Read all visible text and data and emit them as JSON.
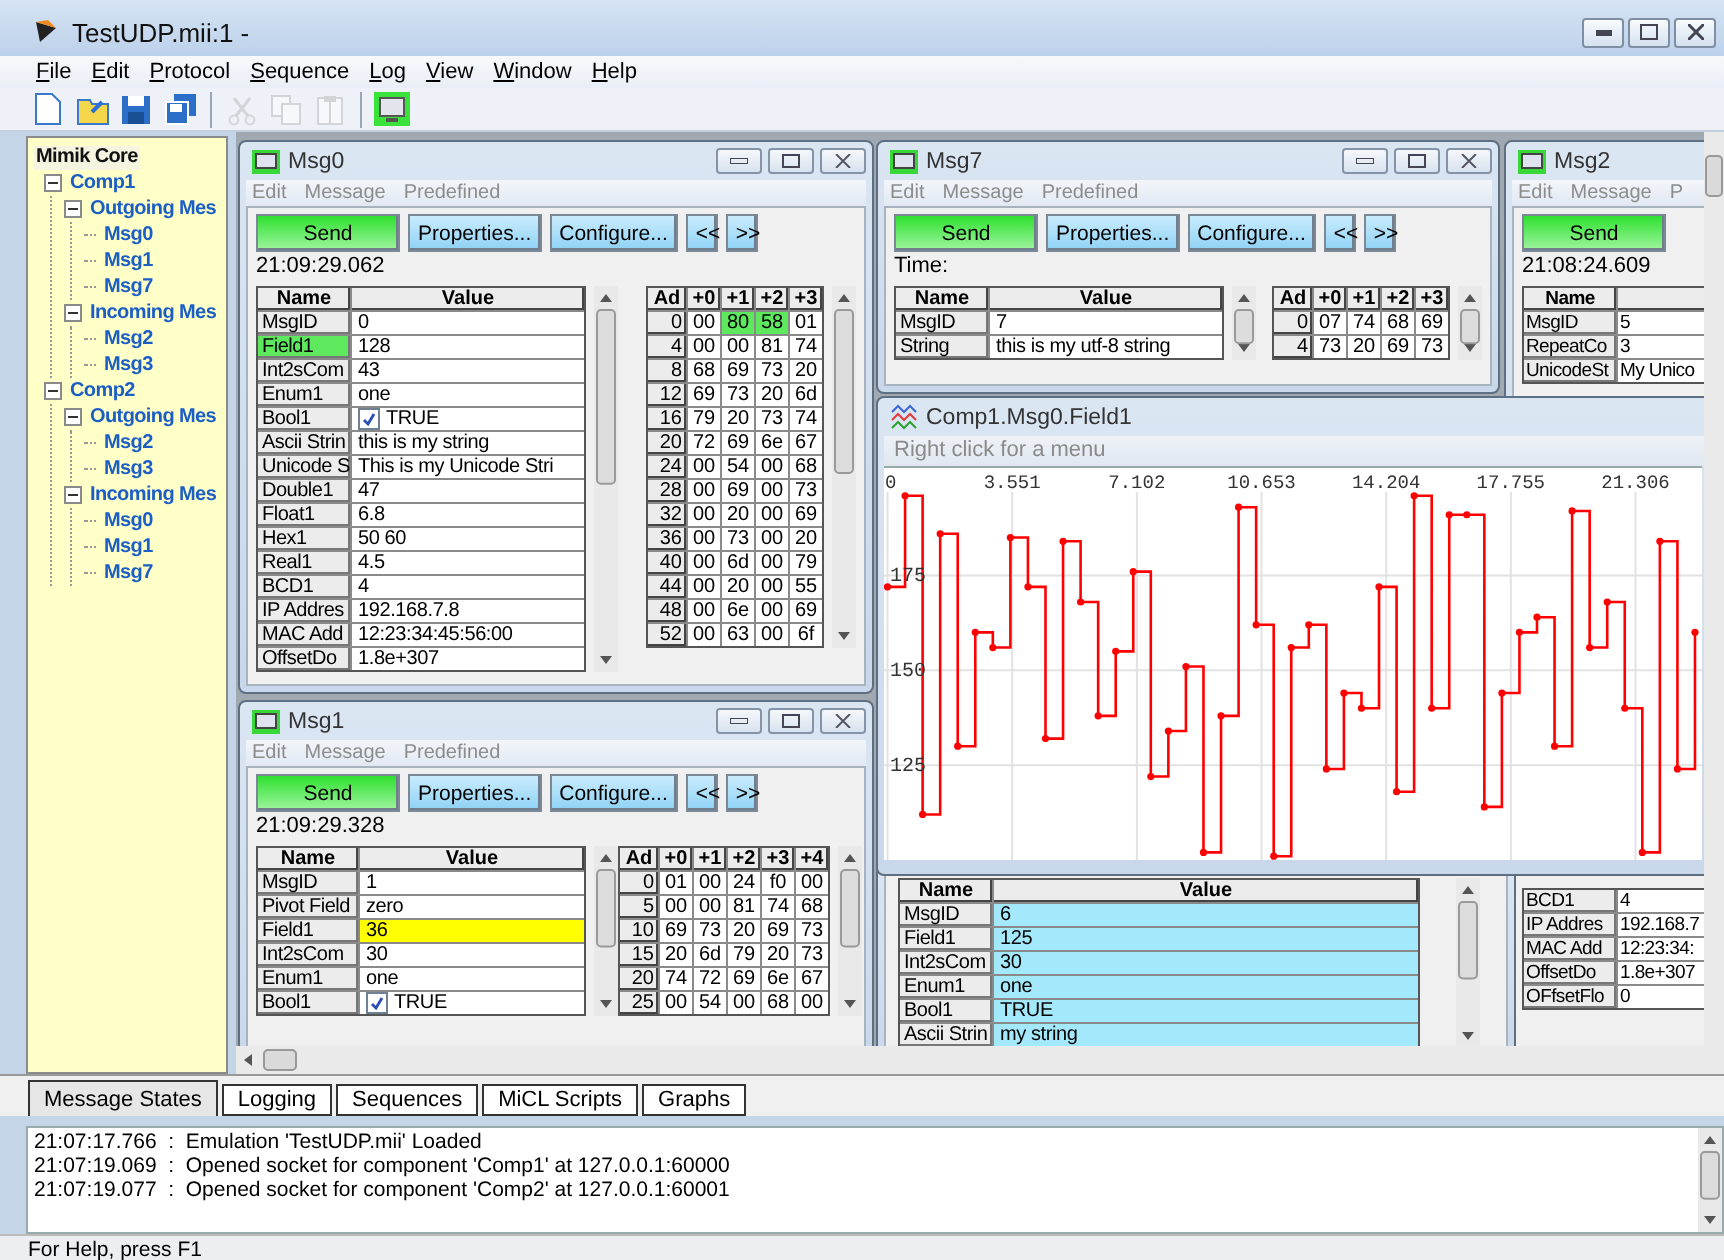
{
  "window": {
    "title": "TestUDP.mii:1 -"
  },
  "menu": [
    "File",
    "Edit",
    "Protocol",
    "Sequence",
    "Log",
    "View",
    "Window",
    "Help"
  ],
  "toolbar": [
    {
      "kind": "new",
      "disabled": false
    },
    {
      "kind": "open",
      "disabled": false
    },
    {
      "kind": "save",
      "disabled": false
    },
    {
      "kind": "save_all",
      "disabled": false
    },
    {
      "kind": "separator"
    },
    {
      "kind": "cut",
      "disabled": true
    },
    {
      "kind": "copy",
      "disabled": true
    },
    {
      "kind": "paste",
      "disabled": true
    },
    {
      "kind": "separator"
    },
    {
      "kind": "monitor",
      "disabled": false
    }
  ],
  "tree": {
    "label": "Mimik Core",
    "selected": true,
    "children": [
      {
        "label": "Comp1",
        "selected": false,
        "expanded": true,
        "children": [
          {
            "label": "Outgoing Mes",
            "selected": false,
            "expanded": true,
            "children": [
              {
                "label": "Msg0",
                "selected": false
              },
              {
                "label": "Msg1",
                "selected": false
              },
              {
                "label": "Msg7",
                "selected": false
              }
            ]
          },
          {
            "label": "Incoming Mes",
            "selected": false,
            "expanded": true,
            "children": [
              {
                "label": "Msg2",
                "selected": false
              },
              {
                "label": "Msg3",
                "selected": false
              }
            ]
          }
        ]
      },
      {
        "label": "Comp2",
        "selected": false,
        "expanded": true,
        "children": [
          {
            "label": "Outgoing Mes",
            "selected": false,
            "expanded": true,
            "children": [
              {
                "label": "Msg2",
                "selected": false
              },
              {
                "label": "Msg3",
                "selected": false
              }
            ]
          },
          {
            "label": "Incoming Mes",
            "selected": false,
            "expanded": true,
            "children": [
              {
                "label": "Msg0",
                "selected": false
              },
              {
                "label": "Msg1",
                "selected": false
              },
              {
                "label": "Msg7",
                "selected": false
              }
            ]
          }
        ]
      }
    ]
  },
  "windows": [
    {
      "kind": "message",
      "title": "Msg0",
      "menu": [
        "Edit",
        "Message",
        "Predefined"
      ],
      "buttons": [
        "Send",
        "Properties...",
        "Configure...",
        "<<",
        ">>"
      ],
      "time": "21:09:29.062",
      "columns": [
        "Name",
        "Value"
      ],
      "fields": [
        {
          "name": "MsgID",
          "value": "0"
        },
        {
          "name": "Field1",
          "value": "128",
          "name_highlighted": true,
          "color": "#5ee85e"
        },
        {
          "name": "Int2sCom",
          "value": "43"
        },
        {
          "name": "Enum1",
          "value": "one"
        },
        {
          "name": "Bool1",
          "value": "TRUE",
          "kind": "checkbox",
          "checked": true
        },
        {
          "name": "Ascii Strin",
          "value": "this is my string"
        },
        {
          "name": "Unicode S",
          "value": "This is my Unicode Stri"
        },
        {
          "name": "Double1",
          "value": "47"
        },
        {
          "name": "Float1",
          "value": "6.8"
        },
        {
          "name": "Hex1",
          "value": "50 60"
        },
        {
          "name": "Real1",
          "value": "4.5"
        },
        {
          "name": "BCD1",
          "value": "4"
        },
        {
          "name": "IP Addres",
          "value": "192.168.7.8"
        },
        {
          "name": "MAC Add",
          "value": "12:23:34:45:56:00"
        },
        {
          "name": "OffsetDo",
          "value": "1.8e+307"
        }
      ],
      "hex": {
        "columns": [
          "Ad",
          "+0",
          "+1",
          "+2",
          "+3"
        ],
        "rows": [
          {
            "address": "0",
            "bytes": [
              "00",
              "80",
              "58",
              "01"
            ],
            "highlights": [
              false,
              true,
              true,
              false
            ]
          },
          {
            "address": "4",
            "bytes": [
              "00",
              "00",
              "81",
              "74"
            ]
          },
          {
            "address": "8",
            "bytes": [
              "68",
              "69",
              "73",
              "20"
            ]
          },
          {
            "address": "12",
            "bytes": [
              "69",
              "73",
              "20",
              "6d"
            ]
          },
          {
            "address": "16",
            "bytes": [
              "79",
              "20",
              "73",
              "74"
            ]
          },
          {
            "address": "20",
            "bytes": [
              "72",
              "69",
              "6e",
              "67"
            ]
          },
          {
            "address": "24",
            "bytes": [
              "00",
              "54",
              "00",
              "68"
            ]
          },
          {
            "address": "28",
            "bytes": [
              "00",
              "69",
              "00",
              "73"
            ]
          },
          {
            "address": "32",
            "bytes": [
              "00",
              "20",
              "00",
              "69"
            ]
          },
          {
            "address": "36",
            "bytes": [
              "00",
              "73",
              "00",
              "20"
            ]
          },
          {
            "address": "40",
            "bytes": [
              "00",
              "6d",
              "00",
              "79"
            ]
          },
          {
            "address": "44",
            "bytes": [
              "00",
              "20",
              "00",
              "55"
            ]
          },
          {
            "address": "48",
            "bytes": [
              "00",
              "6e",
              "00",
              "69"
            ]
          },
          {
            "address": "52",
            "bytes": [
              "00",
              "63",
              "00",
              "6f"
            ]
          }
        ]
      }
    },
    {
      "kind": "message",
      "title": "Msg7",
      "menu": [
        "Edit",
        "Message",
        "Predefined"
      ],
      "buttons": [
        "Send",
        "Properties...",
        "Configure...",
        "<<",
        ">>"
      ],
      "time": "Time:",
      "columns": [
        "Name",
        "Value"
      ],
      "fields": [
        {
          "name": "MsgID",
          "value": "7"
        },
        {
          "name": "String",
          "value": "this is my utf-8 string"
        }
      ],
      "hex": {
        "columns": [
          "Ad",
          "+0",
          "+1",
          "+2",
          "+3"
        ],
        "rows": [
          {
            "address": "0",
            "bytes": [
              "07",
              "74",
              "68",
              "69"
            ]
          },
          {
            "address": "4",
            "bytes": [
              "73",
              "20",
              "69",
              "73"
            ]
          }
        ]
      }
    },
    {
      "kind": "message",
      "title": "Msg2",
      "menu": [
        "Edit",
        "Message",
        "P"
      ],
      "buttons": [
        "Send"
      ],
      "time": "21:08:24.609",
      "columns": [
        "Name"
      ],
      "fields": [
        {
          "name": "MsgID",
          "value": "5"
        },
        {
          "name": "RepeatCo",
          "value": "3"
        },
        {
          "name": "UnicodeSt",
          "value": "My Unico"
        }
      ],
      "fields_below": [
        {
          "name": "BCD1",
          "value": "4"
        },
        {
          "name": "IP Addres",
          "value": "192.168.7"
        },
        {
          "name": "MAC Add",
          "value": "12:23:34:"
        },
        {
          "name": "OffsetDo",
          "value": "1.8e+307"
        },
        {
          "name": "OFfsetFlo",
          "value": "0"
        }
      ]
    },
    {
      "kind": "graph",
      "title": "Comp1.Msg0.Field1",
      "hint": "Right click for a menu",
      "chart_data": {
        "type": "line",
        "grid": true,
        "x": [
          0,
          0.5,
          0.5,
          1,
          1,
          1.5,
          1.5,
          2,
          2,
          2.5,
          2.5,
          3,
          3,
          3.5,
          3.5,
          4,
          4,
          4.5,
          4.5,
          5,
          5,
          5.5,
          5.5,
          6,
          6,
          6.5,
          6.5,
          7,
          7,
          7.5,
          7.5,
          8,
          8,
          8.5,
          8.5,
          9,
          9,
          9.5,
          9.5,
          10,
          10,
          10.5,
          10.5,
          11,
          11,
          11.5,
          11.5,
          12,
          12,
          12.5,
          12.5,
          13,
          13,
          13.5,
          13.5,
          14,
          14,
          14.5,
          14.5,
          15,
          15,
          15.5,
          15.5,
          16,
          16,
          16.5,
          16.5,
          17,
          17,
          17.5,
          17.5,
          18,
          18,
          18.5,
          18.5,
          19,
          19,
          19.5,
          19.5,
          20,
          20,
          20.5,
          20.5,
          21,
          21,
          21.5,
          21.5,
          22,
          22,
          22.5,
          22.5,
          23,
          23
        ],
        "series": [
          {
            "color": "#ff0000",
            "marker": "circle",
            "values": [
              172,
              172,
              196,
              196,
              112,
              112,
              186,
              186,
              130,
              130,
              160,
              160,
              156,
              156,
              185,
              185,
              172,
              172,
              132,
              132,
              184,
              184,
              168,
              168,
              138,
              138,
              155,
              155,
              176,
              176,
              122,
              122,
              134,
              134,
              151,
              151,
              102,
              102,
              138,
              138,
              193,
              193,
              162,
              162,
              101,
              101,
              156,
              156,
              162,
              162,
              124,
              124,
              144,
              144,
              140,
              140,
              172,
              172,
              118,
              118,
              196,
              196,
              140,
              140,
              191,
              191,
              191,
              191,
              114,
              114,
              144,
              144,
              160,
              160,
              164,
              164,
              130,
              130,
              192,
              192,
              156,
              156,
              168,
              168,
              140,
              140,
              102,
              102,
              184,
              184,
              124,
              124,
              160
            ]
          }
        ],
        "xlim": [
          -0.1,
          23.2
        ],
        "ylim": [
          100,
          197
        ],
        "xticks": [
          0,
          3.551,
          7.102,
          10.653,
          14.204,
          17.755,
          21.306
        ],
        "yticks": [
          125,
          150,
          175
        ]
      }
    },
    {
      "kind": "message",
      "title": "Msg1",
      "menu": [
        "Edit",
        "Message",
        "Predefined"
      ],
      "buttons": [
        "Send",
        "Properties...",
        "Configure...",
        "<<",
        ">>"
      ],
      "time": "21:09:29.328",
      "columns": [
        "Name",
        "Value"
      ],
      "fields": [
        {
          "name": "MsgID",
          "value": "1"
        },
        {
          "name": "Pivot Field",
          "value": "zero"
        },
        {
          "name": "Field1",
          "value": "36",
          "name_highlighted": false,
          "color": "#ffff00"
        },
        {
          "name": "Int2sCom",
          "value": "30"
        },
        {
          "name": "Enum1",
          "value": "one"
        },
        {
          "name": "Bool1",
          "value": "TRUE",
          "kind": "checkbox",
          "checked": true
        }
      ],
      "hex": {
        "columns": [
          "Ad",
          "+0",
          "+1",
          "+2",
          "+3",
          "+4"
        ],
        "rows": [
          {
            "address": "0",
            "bytes": [
              "01",
              "00",
              "24",
              "f0",
              "00"
            ]
          },
          {
            "address": "5",
            "bytes": [
              "00",
              "00",
              "81",
              "74",
              "68"
            ]
          },
          {
            "address": "10",
            "bytes": [
              "69",
              "73",
              "20",
              "69",
              "73"
            ]
          },
          {
            "address": "15",
            "bytes": [
              "20",
              "6d",
              "79",
              "20",
              "73"
            ]
          },
          {
            "address": "20",
            "bytes": [
              "74",
              "72",
              "69",
              "6e",
              "67"
            ]
          },
          {
            "address": "25",
            "bytes": [
              "00",
              "54",
              "00",
              "68",
              "00"
            ]
          }
        ]
      }
    },
    {
      "kind": "fields_only",
      "columns": [
        "Name",
        "Value"
      ],
      "fields": [
        {
          "name": "MsgID",
          "value": "6",
          "name_highlighted": false,
          "color": "#a3e9fb"
        },
        {
          "name": "Field1",
          "value": "125",
          "name_highlighted": false,
          "color": "#a3e9fb"
        },
        {
          "name": "Int2sCom",
          "value": "30",
          "name_highlighted": false,
          "color": "#a3e9fb"
        },
        {
          "name": "Enum1",
          "value": "one",
          "name_highlighted": false,
          "color": "#a3e9fb"
        },
        {
          "name": "Bool1",
          "value": "TRUE",
          "name_highlighted": false,
          "color": "#a3e9fb"
        },
        {
          "name": "Ascii Strin",
          "value": "my string",
          "name_highlighted": false,
          "color": "#a3e9fb"
        }
      ]
    }
  ],
  "tabs": [
    {
      "label": "Message States",
      "selected": true
    },
    {
      "label": "Logging",
      "selected": false
    },
    {
      "label": "Sequences",
      "selected": false
    },
    {
      "label": "MiCL Scripts",
      "selected": false
    },
    {
      "label": "Graphs",
      "selected": false
    }
  ],
  "log": [
    "21:07:17.766  :  Emulation 'TestUDP.mii' Loaded",
    "21:07:19.069  :  Opened socket for component 'Comp1' at 127.0.0.1:60000",
    "21:07:19.077  :  Opened socket for component 'Comp2' at 127.0.0.1:60001"
  ],
  "status_bar": "For Help, press F1"
}
